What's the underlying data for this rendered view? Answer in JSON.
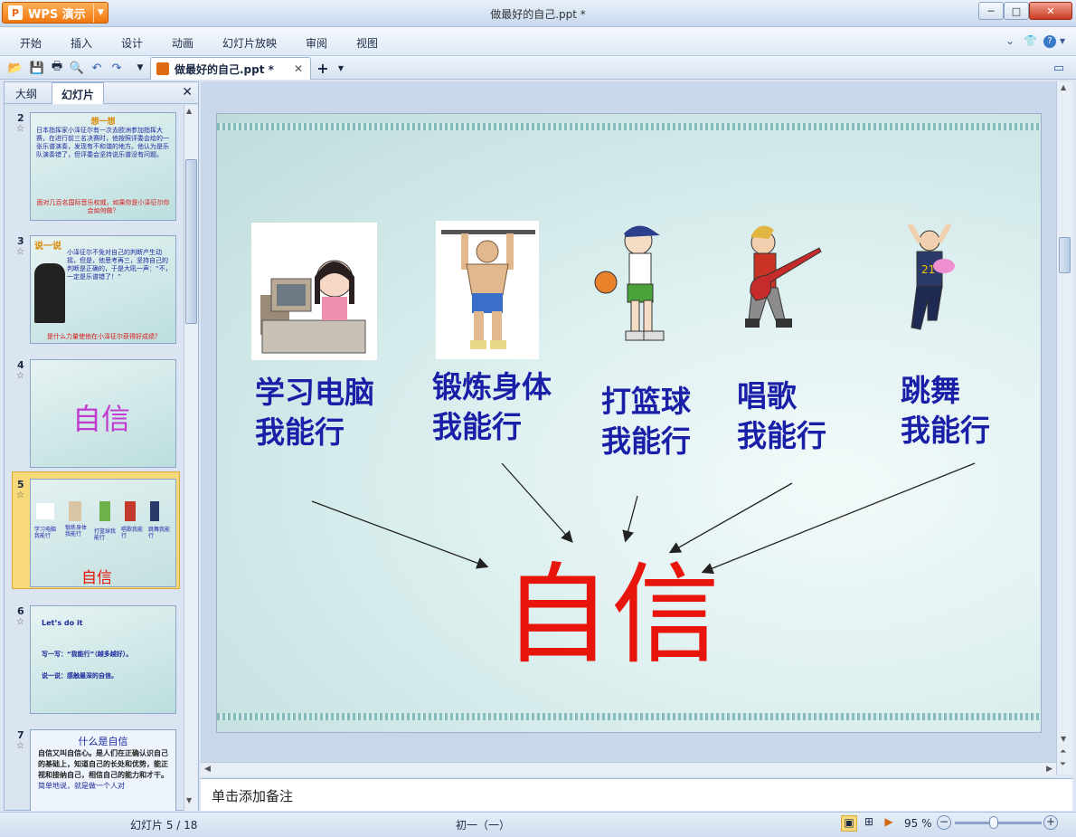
{
  "app": {
    "name": "WPS 演示",
    "logo": "P"
  },
  "window": {
    "title": "做最好的自己.ppt *"
  },
  "menu": [
    "开始",
    "插入",
    "设计",
    "动画",
    "幻灯片放映",
    "审阅",
    "视图"
  ],
  "tab": {
    "label": "做最好的自己.ppt *"
  },
  "left_panel": {
    "tabs": [
      "大纲",
      "幻灯片"
    ],
    "slides": [
      {
        "num": "2",
        "title": "想一想",
        "body": "日本指挥家小泽征尔有一次去欧洲参加指挥大赛，在进行前三名决赛时，他按照评委会给的一张乐谱演奏，发现有不和谐的地方。他认为是乐队演奏错了，但评委会坚持说乐谱没有问题。",
        "footer": "面对几百名国际音乐权威，如果你是小泽征尔你会如何做？"
      },
      {
        "num": "3",
        "title": "说一说",
        "body": "小泽征尔不免对自己的判断产生动摇，但是，他思考再三，坚持自己的判断是正确的，于是大吼一声：“不，一定是乐谱错了！”",
        "footer": "是什么力量使他在小泽征尔获得好成绩？"
      },
      {
        "num": "4",
        "big": "自信"
      },
      {
        "num": "5",
        "captions": [
          "学习电脑我能行",
          "锻炼身体我能行",
          "打篮球我能行",
          "唱歌我能行",
          "跳舞我能行"
        ],
        "big": "自信"
      },
      {
        "num": "6",
        "lines": [
          "Let’s do it",
          "写一写：“我能行”（越多越好）。",
          "说一说：感触最深的自信。"
        ]
      },
      {
        "num": "7",
        "title": "什么是自信",
        "body": "自信又叫自信心。是人们在正确认识自己的基础上，知道自己的长处和优势，能正视和接纳自己，相信自己的能力和才干。",
        "footer": "简单地说，就是做一个人对"
      }
    ]
  },
  "slide": {
    "captions": [
      {
        "line1": "学习电脑",
        "line2": "我能行"
      },
      {
        "line1": "锻炼身体",
        "line2": "我能行"
      },
      {
        "line1": "打篮球",
        "line2": "我能行"
      },
      {
        "line1": "唱歌",
        "line2": "我能行"
      },
      {
        "line1": "跳舞",
        "line2": "我能行"
      }
    ],
    "center_word": "自信"
  },
  "notes": {
    "placeholder": "单击添加备注"
  },
  "status": {
    "slide_counter": "幻灯片 5 / 18",
    "theme": "初一（一）",
    "zoom": "95 %"
  },
  "colors": {
    "accent": "#f0770e",
    "caption": "#1a1fa8",
    "center": "#e8150c"
  }
}
